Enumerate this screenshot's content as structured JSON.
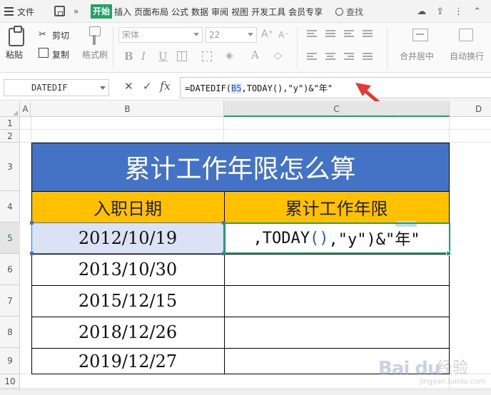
{
  "menubar": {
    "file_label": "文件",
    "more": "»",
    "active_tab": "开始",
    "tabs": [
      "插入",
      "页面布局",
      "公式",
      "数据",
      "审阅",
      "视图",
      "开发工具",
      "会员专享"
    ],
    "search_label": "查找",
    "right_icons": [
      "cloud-sync-icon",
      "share-icon",
      "more-dots-icon",
      "collapse-icon"
    ]
  },
  "ribbon": {
    "paste_label": "粘贴",
    "cut_label": "剪切",
    "copy_label": "复制",
    "format_painter_label": "格式刷",
    "font_name": "宋体",
    "font_size": "22",
    "merge_label": "合并居中",
    "wrap_label": "自动换行"
  },
  "formula_bar": {
    "name_box": "DATEDIF",
    "cancel_symbol": "✕",
    "confirm_symbol": "✓",
    "fx_label": "fx",
    "formula_before": "=DATEDIF(",
    "formula_ref": "B5",
    "formula_after": ",TODAY(),\"y\")&\"年\""
  },
  "columns": [
    "A",
    "B",
    "C",
    "D"
  ],
  "rows": [
    "1",
    "2",
    "3",
    "4",
    "5",
    "6",
    "7",
    "8",
    "9",
    "10"
  ],
  "table": {
    "title": "累计工作年限怎么算",
    "header_b": "入职日期",
    "header_c": "累计工作年限",
    "dates": [
      "2012/10/19",
      "2013/10/30",
      "2015/12/15",
      "2018/12/26",
      "2019/12/27"
    ],
    "c5_editing_text_1": ",TODAY",
    "c5_paren": "()",
    "c5_editing_text_2": ",\"y\")&\"年\""
  },
  "colors": {
    "title_fill": "#4472c4",
    "header_fill": "#ffc000",
    "selection_green": "#21a366",
    "arrow_red": "#e53935"
  },
  "watermark": {
    "brand": "Bai du",
    "suffix": "经验",
    "url": "jingyan.baidu.com"
  }
}
